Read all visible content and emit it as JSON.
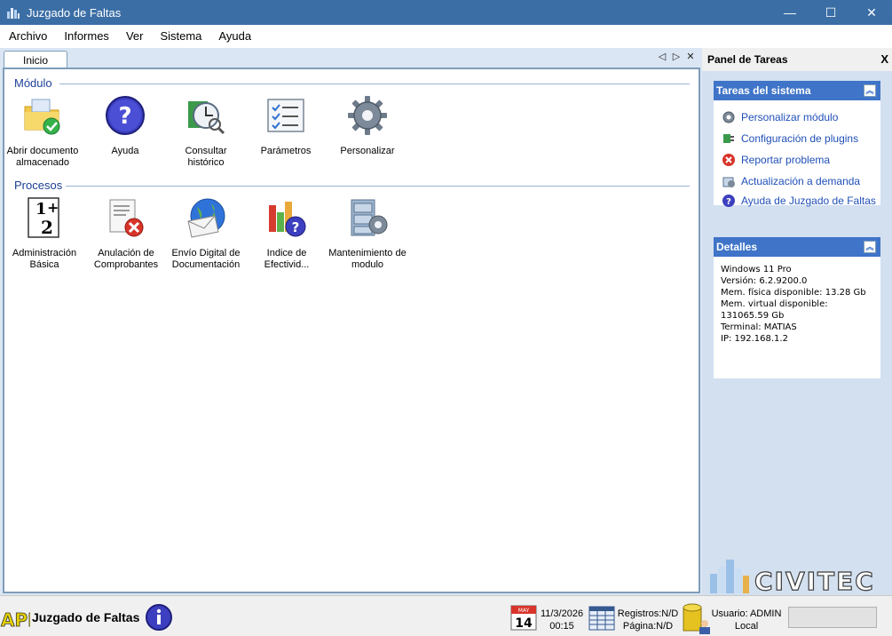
{
  "window": {
    "title": "Juzgado de Faltas",
    "controls": {
      "minimize": "—",
      "maximize": "☐",
      "close": "✕"
    }
  },
  "menu": [
    "Archivo",
    "Informes",
    "Ver",
    "Sistema",
    "Ayuda"
  ],
  "tabs": {
    "active": "Inicio",
    "nav_left": "◁",
    "nav_right": "▷",
    "close": "✕"
  },
  "groups": {
    "modulo": {
      "title": "Módulo",
      "items": [
        {
          "label": "Abrir documento almacenado",
          "icon": "folder-check-icon"
        },
        {
          "label": "Ayuda",
          "icon": "help-icon"
        },
        {
          "label": "Consultar histórico",
          "icon": "history-clock-icon"
        },
        {
          "label": "Parámetros",
          "icon": "checklist-icon"
        },
        {
          "label": "Personalizar",
          "icon": "gear-icon"
        }
      ]
    },
    "procesos": {
      "title": "Procesos",
      "items": [
        {
          "label": "Administración Básica",
          "icon": "numbers-icon"
        },
        {
          "label": "Anulación de Comprobantes",
          "icon": "document-cancel-icon"
        },
        {
          "label": "Envío Digital de Documentación",
          "icon": "globe-mail-icon"
        },
        {
          "label": "Indice de Efectivid...",
          "icon": "chart-help-icon"
        },
        {
          "label": "Mantenimiento de modulo",
          "icon": "cabinet-gear-icon"
        }
      ]
    }
  },
  "task_panel": {
    "title": "Panel de Tareas",
    "close": "X",
    "system_tasks": {
      "title": "Tareas del sistema",
      "collapse": "︽",
      "items": [
        {
          "label": "Personalizar módulo",
          "icon": "gear-icon"
        },
        {
          "label": "Configuración de plugins",
          "icon": "plugin-icon"
        },
        {
          "label": "Reportar problema",
          "icon": "error-icon"
        },
        {
          "label": "Actualización a demanda",
          "icon": "update-icon"
        },
        {
          "label": "Ayuda de Juzgado de Faltas",
          "icon": "help-icon"
        }
      ]
    },
    "details": {
      "title": "Detalles",
      "collapse": "︽",
      "lines": [
        "Windows 11 Pro",
        "Versión: 6.2.9200.0",
        "Mem. física disponible: 13.28 Gb",
        "Mem. virtual disponible:",
        "131065.59 Gb",
        "Terminal: MATIAS",
        "IP: 192.168.1.2"
      ]
    },
    "logo_text": "CIVITEC"
  },
  "statusbar": {
    "brand_mark": "API",
    "brand": "Juzgado de Faltas",
    "calendar_month": "MAY",
    "calendar_day": "14",
    "date": "11/3/2026",
    "time": "00:15",
    "registros": "Registros:N/D",
    "pagina": "Página:N/D",
    "usuario": "Usuario: ADMIN",
    "location": "Local"
  },
  "colors": {
    "titlebar": "#3b6ea5",
    "accent": "#3f74c8",
    "link": "#1f4fb8",
    "group_title": "#1c3f95"
  }
}
